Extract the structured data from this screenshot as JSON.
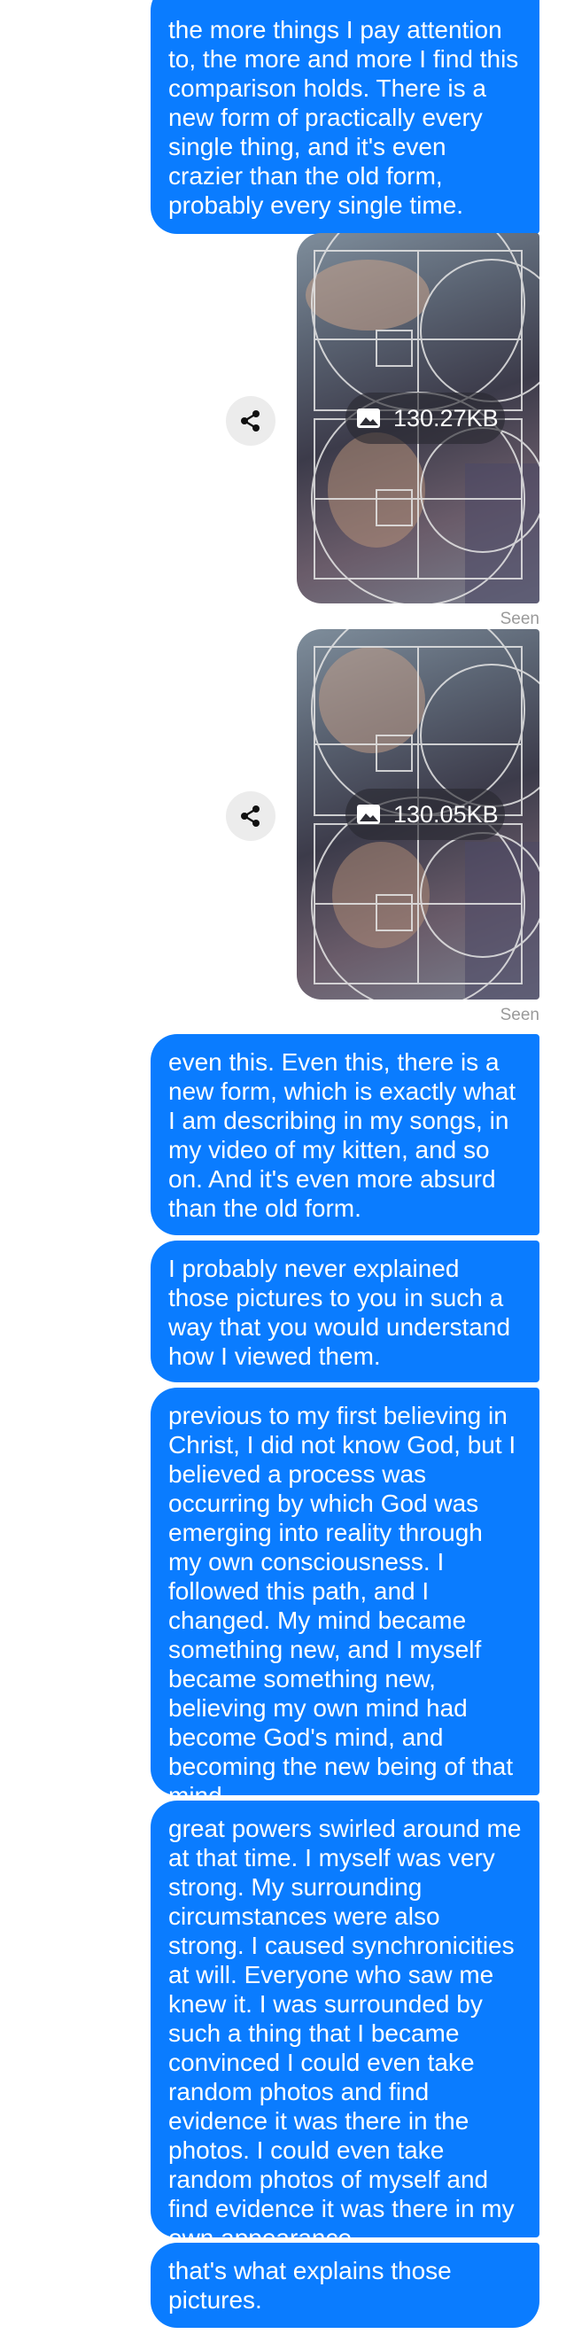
{
  "messages": [
    {
      "text": "the more things I pay attention to, the more and more I find this comparison holds. There is a new form of practically every single thing, and it's even crazier than the old form, probably every single time."
    },
    {
      "text": "even this. Even this, there is a new form, which is exactly what I am describing in my songs, in my video of my kitten, and so on. And it's even more absurd than the old form."
    },
    {
      "text": "I probably never explained those pictures to you in such a way that you would understand how I viewed them."
    },
    {
      "text": "previous to my first believing in Christ, I did not know God, but I believed a process was occurring by which God was emerging into reality through my own consciousness. I followed this path, and I changed. My mind became something new, and I myself became something new, believing my own mind had become God's mind, and becoming the new being of that mind."
    },
    {
      "text": "great powers swirled around me at that time. I myself was very strong. My surrounding circumstances were also strong. I caused synchronicities at will. Everyone who saw me knew it. I was surrounded by such a thing that I became convinced I could even take random photos and find evidence it was there in the photos. I could even take random photos of myself and find evidence it was there in my own appearance."
    },
    {
      "text": "that's what explains those pictures."
    }
  ],
  "images": [
    {
      "size_label": "130.27KB",
      "status": "Seen",
      "icon": "image-icon"
    },
    {
      "size_label": "130.05KB",
      "status": "Seen",
      "icon": "image-icon"
    }
  ],
  "share_icon": "share-icon",
  "colors": {
    "bubble": "#0a7cff",
    "bubble_text": "#ffffff",
    "seen_text": "#9a9a9a",
    "share_bg": "#ececec"
  }
}
